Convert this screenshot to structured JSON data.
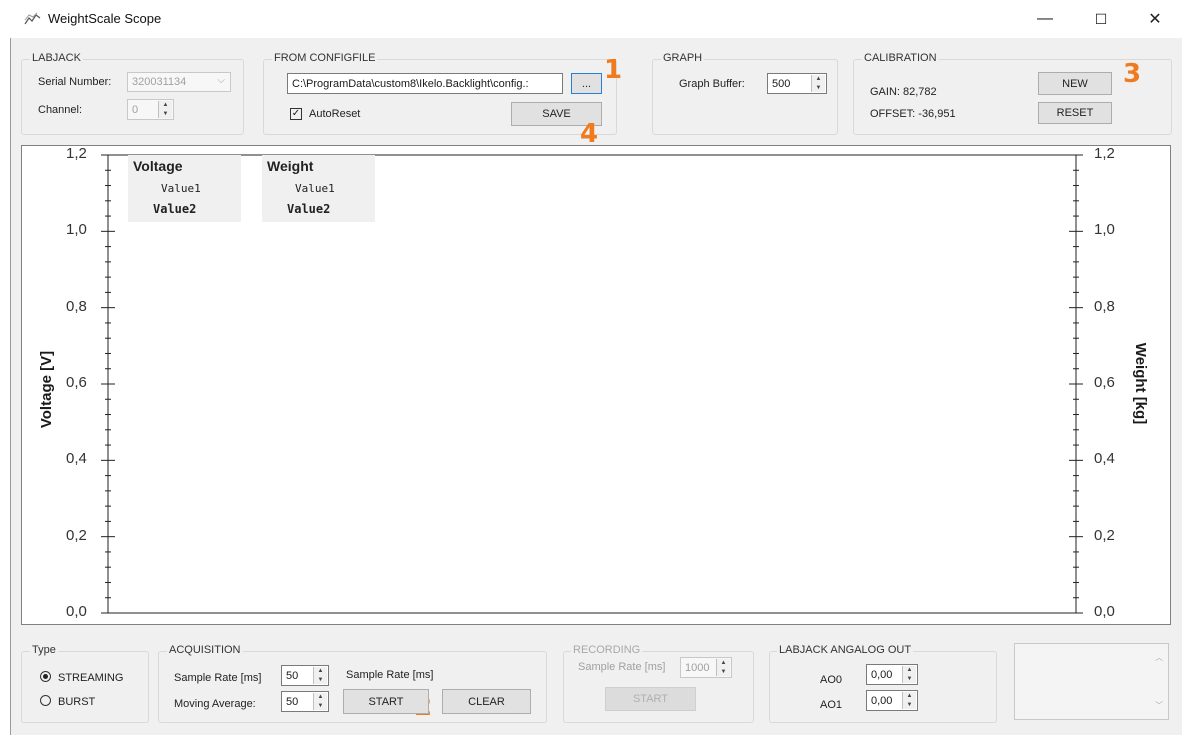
{
  "window": {
    "title": "WeightScale Scope",
    "controls": {
      "minimize": "—",
      "maximize": "☐",
      "close": "✕"
    }
  },
  "labjack": {
    "group_label": "LABJACK",
    "serial_label": "Serial Number:",
    "serial_value": "320031134",
    "channel_label": "Channel:",
    "channel_value": "0"
  },
  "configfile": {
    "group_label": "FROM CONFIGFILE",
    "path_value": "C:\\ProgramData\\custom8\\Ikelo.Backlight\\config.:",
    "browse_label": "...",
    "autoreset_label": "AutoReset",
    "autoreset_checked": true,
    "save_label": "SAVE"
  },
  "graph": {
    "group_label": "GRAPH",
    "buffer_label": "Graph Buffer:",
    "buffer_value": "500"
  },
  "calibration": {
    "group_label": "CALIBRATION",
    "gain_text": "GAIN: 82,782",
    "offset_text": "OFFSET: -36,951",
    "new_label": "NEW",
    "reset_label": "RESET"
  },
  "badges": {
    "b1": "1",
    "b2": "2",
    "b3": "3",
    "b4": "4"
  },
  "plot": {
    "left_axis_label": "Voltage [V]",
    "right_axis_label": "Weight [kg]",
    "left_ticks": [
      "1,2",
      "1,0",
      "0,8",
      "0,6",
      "0,4",
      "0,2",
      "0,0"
    ],
    "right_ticks": [
      "1,2",
      "1,0",
      "0,8",
      "0,6",
      "0,4",
      "0,2",
      "0,0"
    ],
    "legend": [
      {
        "title": "Voltage",
        "value1": "Value1",
        "value2": "Value2"
      },
      {
        "title": "Weight",
        "value1": "Value1",
        "value2": "Value2"
      }
    ]
  },
  "type": {
    "group_label": "Type",
    "streaming_label": "STREAMING",
    "burst_label": "BURST",
    "selected": "STREAMING"
  },
  "acquisition": {
    "group_label": "ACQUISITION",
    "sample_rate_label": "Sample Rate [ms]",
    "sample_rate_value": "50",
    "sample_rate_label2": "Sample Rate [ms]",
    "moving_avg_label": "Moving Average:",
    "moving_avg_value": "50",
    "start_label": "START",
    "clear_label": "CLEAR"
  },
  "recording": {
    "group_label": "RECORDING",
    "sample_rate_label": "Sample Rate [ms]",
    "sample_rate_value": "1000",
    "start_label": "START"
  },
  "analog_out": {
    "group_label": "LABJACK ANGALOG OUT",
    "ao0_label": "AO0",
    "ao0_value": "0,00",
    "ao1_label": "AO1",
    "ao1_value": "0,00"
  },
  "colors": {
    "badge": "#f07a1e",
    "window_bg": "#f0f0f0"
  }
}
